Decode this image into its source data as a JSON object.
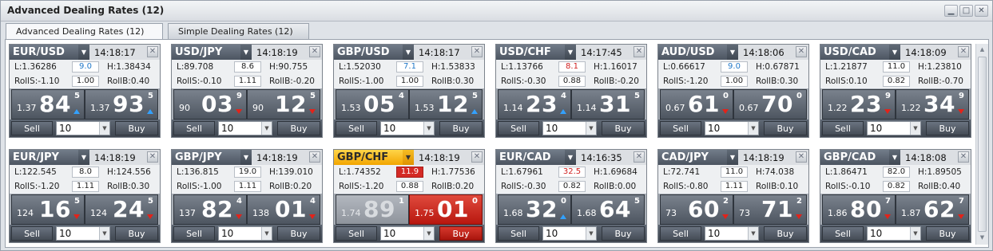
{
  "window": {
    "title": "Advanced Dealing Rates (12)",
    "controls": [
      "▁",
      "□",
      "✕"
    ]
  },
  "tabs": [
    {
      "label": "Advanced Dealing Rates (12)"
    },
    {
      "label": "Simple Dealing Rates (12)"
    }
  ],
  "labels": {
    "sell": "Sell",
    "buy": "Buy",
    "close": "✕",
    "dropdown": "▼"
  },
  "colors": {
    "up": "#33a1ff",
    "down": "#e2231a",
    "highlight": "#ffc21a",
    "alert": "#d42a25"
  },
  "tiles": [
    {
      "pair": "EUR/USD",
      "time": "14:18:17",
      "low": "L:1.36286",
      "spread": "9.0",
      "spread_style": "blue",
      "high": "H:1.38434",
      "rolls": "RollS:-1.10",
      "roll_mid": "1.00",
      "rollb": "RollB:0.40",
      "sell": {
        "small": "1.37",
        "big": "84",
        "pip": "5",
        "arrow": "up"
      },
      "buy": {
        "small": "1.37",
        "big": "93",
        "pip": "5",
        "arrow": "up"
      },
      "qty": "10"
    },
    {
      "pair": "USD/JPY",
      "time": "14:18:19",
      "low": "L:89.708",
      "spread": "8.6",
      "spread_style": "",
      "high": "H:90.755",
      "rolls": "RollS:-0.10",
      "roll_mid": "1.11",
      "rollb": "RollB:-0.20",
      "sell": {
        "small": "90",
        "big": "03",
        "pip": "9",
        "arrow": "down"
      },
      "buy": {
        "small": "90",
        "big": "12",
        "pip": "5",
        "arrow": "down"
      },
      "qty": "10"
    },
    {
      "pair": "GBP/USD",
      "time": "14:18:17",
      "low": "L:1.52030",
      "spread": "7.1",
      "spread_style": "blue",
      "high": "H:1.53833",
      "rolls": "RollS:-1.00",
      "roll_mid": "1.00",
      "rollb": "RollB:0.30",
      "sell": {
        "small": "1.53",
        "big": "05",
        "pip": "4",
        "arrow": ""
      },
      "buy": {
        "small": "1.53",
        "big": "12",
        "pip": "5",
        "arrow": "up"
      },
      "qty": "10"
    },
    {
      "pair": "USD/CHF",
      "time": "14:17:45",
      "low": "L:1.13766",
      "spread": "8.1",
      "spread_style": "red",
      "high": "H:1.16017",
      "rolls": "RollS:-0.30",
      "roll_mid": "0.88",
      "rollb": "RollB:-0.20",
      "sell": {
        "small": "1.14",
        "big": "23",
        "pip": "4",
        "arrow": "up"
      },
      "buy": {
        "small": "1.14",
        "big": "31",
        "pip": "5",
        "arrow": ""
      },
      "qty": "10"
    },
    {
      "pair": "AUD/USD",
      "time": "14:18:06",
      "low": "L:0.66617",
      "spread": "9.0",
      "spread_style": "blue",
      "high": "H:0.67871",
      "rolls": "RollS:-1.20",
      "roll_mid": "1.00",
      "rollb": "RollB:0.30",
      "sell": {
        "small": "0.67",
        "big": "61",
        "pip": "0",
        "arrow": "down"
      },
      "buy": {
        "small": "0.67",
        "big": "70",
        "pip": "0",
        "arrow": ""
      },
      "qty": "10"
    },
    {
      "pair": "USD/CAD",
      "time": "14:18:09",
      "low": "L:1.21877",
      "spread": "11.0",
      "spread_style": "",
      "high": "H:1.23810",
      "rolls": "RollS:0.10",
      "roll_mid": "0.82",
      "rollb": "RollB:-0.70",
      "sell": {
        "small": "1.22",
        "big": "23",
        "pip": "9",
        "arrow": "down"
      },
      "buy": {
        "small": "1.22",
        "big": "34",
        "pip": "9",
        "arrow": "down"
      },
      "qty": "10"
    },
    {
      "pair": "EUR/JPY",
      "time": "14:18:19",
      "low": "L:122.545",
      "spread": "8.0",
      "spread_style": "",
      "high": "H:124.556",
      "rolls": "RollS:-1.20",
      "roll_mid": "1.11",
      "rollb": "RollB:0.30",
      "sell": {
        "small": "124",
        "big": "16",
        "pip": "5",
        "arrow": "down"
      },
      "buy": {
        "small": "124",
        "big": "24",
        "pip": "5",
        "arrow": "down"
      },
      "qty": "10"
    },
    {
      "pair": "GBP/JPY",
      "time": "14:18:19",
      "low": "L:136.815",
      "spread": "19.0",
      "spread_style": "",
      "high": "H:139.010",
      "rolls": "RollS:-1.00",
      "roll_mid": "1.11",
      "rollb": "RollB:0.20",
      "sell": {
        "small": "137",
        "big": "82",
        "pip": "4",
        "arrow": "down"
      },
      "buy": {
        "small": "138",
        "big": "01",
        "pip": "4",
        "arrow": "down"
      },
      "qty": "10"
    },
    {
      "pair": "GBP/CHF",
      "time": "14:18:19",
      "low": "L:1.74352",
      "spread": "11.9",
      "spread_style": "alert",
      "high": "H:1.77536",
      "rolls": "RollS:-1.20",
      "roll_mid": "0.88",
      "rollb": "RollB:0.20",
      "sell": {
        "small": "1.74",
        "big": "89",
        "pip": "1",
        "arrow": ""
      },
      "buy": {
        "small": "1.75",
        "big": "01",
        "pip": "0",
        "arrow": ""
      },
      "qty": "10",
      "highlight": true
    },
    {
      "pair": "EUR/CAD",
      "time": "14:16:35",
      "low": "L:1.67961",
      "spread": "32.5",
      "spread_style": "red",
      "high": "H:1.69684",
      "rolls": "RollS:-0.30",
      "roll_mid": "0.82",
      "rollb": "RollB:0.00",
      "sell": {
        "small": "1.68",
        "big": "32",
        "pip": "0",
        "arrow": "up"
      },
      "buy": {
        "small": "1.68",
        "big": "64",
        "pip": "5",
        "arrow": ""
      },
      "qty": "10"
    },
    {
      "pair": "CAD/JPY",
      "time": "14:18:19",
      "low": "L:72.741",
      "spread": "11.0",
      "spread_style": "",
      "high": "H:74.038",
      "rolls": "RollS:-0.80",
      "roll_mid": "1.11",
      "rollb": "RollB:0.10",
      "sell": {
        "small": "73",
        "big": "60",
        "pip": "2",
        "arrow": "down"
      },
      "buy": {
        "small": "73",
        "big": "71",
        "pip": "2",
        "arrow": "down"
      },
      "qty": "10"
    },
    {
      "pair": "GBP/CAD",
      "time": "14:18:08",
      "low": "L:1.86471",
      "spread": "82.0",
      "spread_style": "",
      "high": "H:1.89505",
      "rolls": "RollS:-0.10",
      "roll_mid": "0.82",
      "rollb": "RollB:0.40",
      "sell": {
        "small": "1.86",
        "big": "80",
        "pip": "7",
        "arrow": "down"
      },
      "buy": {
        "small": "1.87",
        "big": "62",
        "pip": "7",
        "arrow": "down"
      },
      "qty": "10"
    }
  ]
}
